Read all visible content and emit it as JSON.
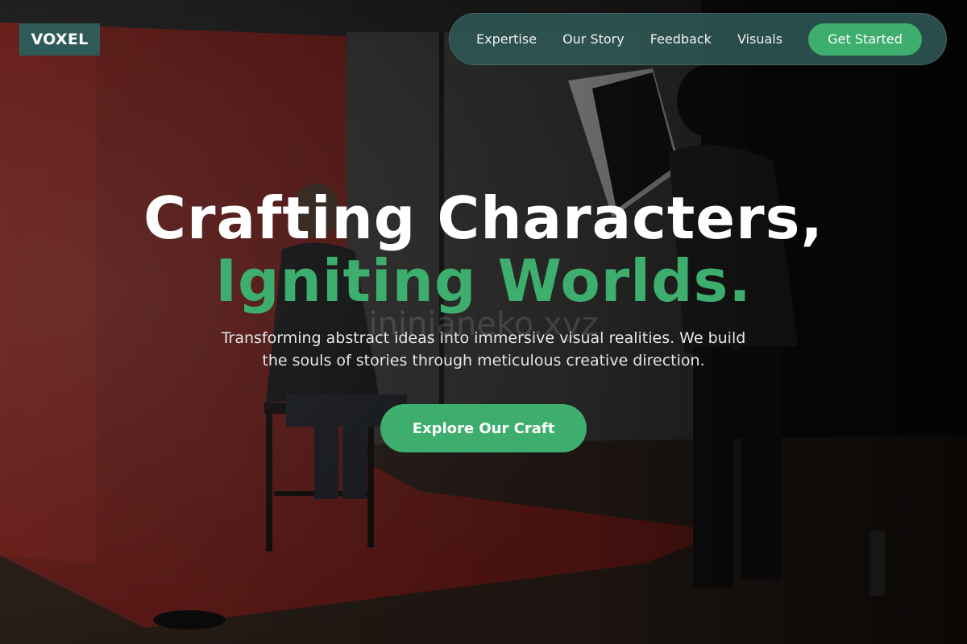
{
  "brand": {
    "logo_text": "VOXEL",
    "accent_color": "#3dae6d",
    "nav_background": "#2f5854"
  },
  "nav": {
    "links": [
      {
        "label": "Expertise"
      },
      {
        "label": "Our Story"
      },
      {
        "label": "Feedback"
      },
      {
        "label": "Visuals"
      }
    ],
    "cta_label": "Get Started"
  },
  "hero": {
    "headline_line1": "Crafting Characters,",
    "headline_line2": "Igniting Worlds.",
    "subtitle": "Transforming abstract ideas into immersive visual realities. We build the souls of stories through meticulous creative direction.",
    "cta_label": "Explore Our Craft",
    "watermark": "ininjaneko.xyz"
  },
  "background": {
    "description_icon": "photo-studio-background",
    "backdrop_color": "#b3261f"
  }
}
